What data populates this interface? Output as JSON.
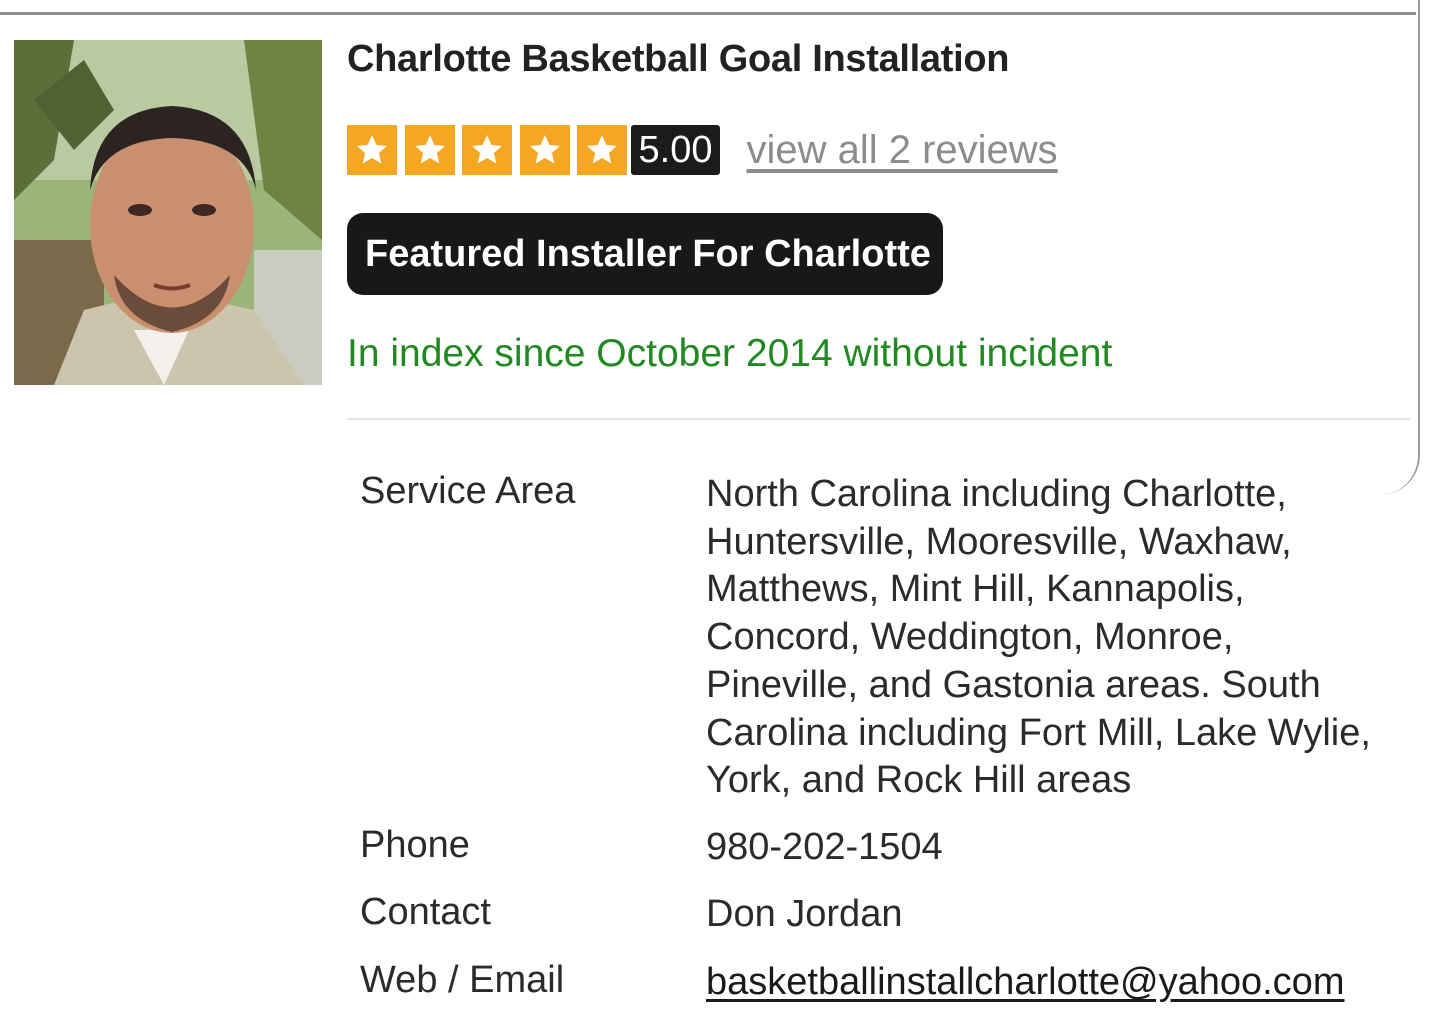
{
  "listing": {
    "title": "Charlotte Basketball Goal Installation",
    "rating": {
      "stars": 5,
      "max_stars": 5,
      "score": "5.00",
      "reviews_link": "view all 2 reviews"
    },
    "badge": "Featured Installer For Charlotte",
    "index_status": "In index since October 2014 without incident"
  },
  "details": {
    "service_area": {
      "label": "Service Area",
      "lines": [
        "North Carolina including Charlotte,",
        "Huntersville, Mooresville, Waxhaw,",
        "Matthews, Mint Hill, Kannapolis,",
        "Concord, Weddington, Monroe,",
        "Pineville, and Gastonia areas. South",
        "Carolina including Fort Mill, Lake Wylie,",
        "York, and Rock Hill areas"
      ]
    },
    "phone": {
      "label": "Phone",
      "value": "980-202-1504"
    },
    "contact": {
      "label": "Contact",
      "value": "Don Jordan"
    },
    "web_email": {
      "label": "Web / Email",
      "value": "basketballinstallcharlotte@yahoo.com"
    }
  },
  "colors": {
    "star_orange": "#f5a623",
    "badge_black": "#181818",
    "status_green": "#1f8a1f",
    "link_gray": "#8c8c8c"
  },
  "icons": {
    "star": "star-icon",
    "avatar": "installer-photo"
  }
}
